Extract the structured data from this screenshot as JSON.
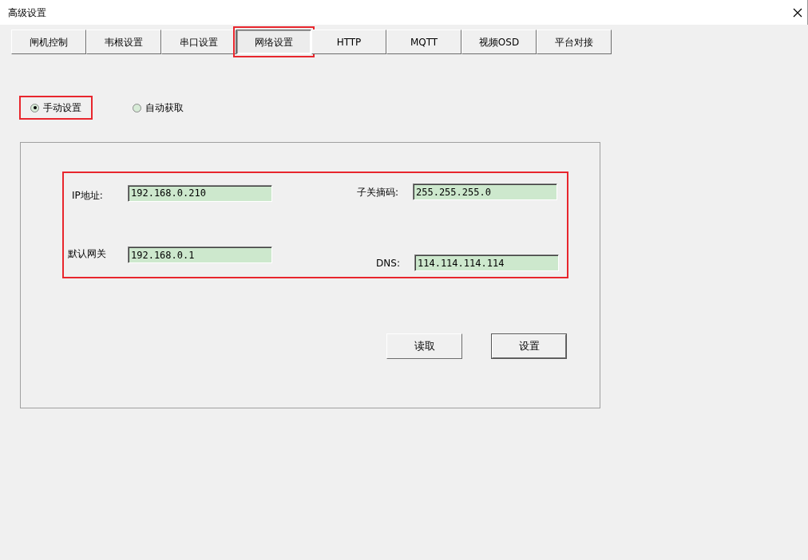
{
  "window": {
    "title": "高级设置"
  },
  "tabs": [
    {
      "label": "闸机控制",
      "selected": false,
      "highlighted": false
    },
    {
      "label": "韦根设置",
      "selected": false,
      "highlighted": false
    },
    {
      "label": "串口设置",
      "selected": false,
      "highlighted": false
    },
    {
      "label": "网络设置",
      "selected": true,
      "highlighted": true
    },
    {
      "label": "HTTP",
      "selected": false,
      "highlighted": false
    },
    {
      "label": "MQTT",
      "selected": false,
      "highlighted": false
    },
    {
      "label": "视频OSD",
      "selected": false,
      "highlighted": false
    },
    {
      "label": "平台对接",
      "selected": false,
      "highlighted": false
    }
  ],
  "mode_options": [
    {
      "label": "手动设置",
      "selected": true,
      "highlighted": true
    },
    {
      "label": "自动获取",
      "selected": false,
      "highlighted": false
    }
  ],
  "network": {
    "highlighted": true,
    "fields": [
      {
        "label": "IP地址:",
        "value": "192.168.0.210"
      },
      {
        "label": "子关摘码:",
        "value": "255.255.255.0"
      },
      {
        "label": "默认网关",
        "value": "192.168.0.1"
      },
      {
        "label": "DNS:",
        "value": "114.114.114.114"
      }
    ]
  },
  "buttons": [
    {
      "label": "读取",
      "default": false
    },
    {
      "label": "设置",
      "default": true
    }
  ]
}
